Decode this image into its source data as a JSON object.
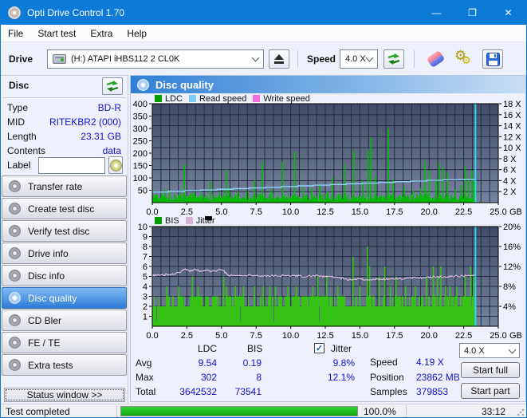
{
  "window": {
    "title": "Opti Drive Control 1.70",
    "controls": {
      "minimize": "—",
      "maximize": "❐",
      "close": "✕"
    }
  },
  "menubar": {
    "items": [
      "File",
      "Start test",
      "Extra",
      "Help"
    ]
  },
  "toolbar": {
    "drive_label": "Drive",
    "drive_value": "(H:)   ATAPI iHBS112   2 CL0K",
    "speed_label": "Speed",
    "speed_value": "4.0 X"
  },
  "sidebar": {
    "disc": {
      "header": "Disc",
      "fields": [
        {
          "label": "Type",
          "value": "BD-R"
        },
        {
          "label": "MID",
          "value": "RITEKBR2 (000)"
        },
        {
          "label": "Length",
          "value": "23.31 GB"
        },
        {
          "label": "Contents",
          "value": "data"
        }
      ],
      "label_field": {
        "label": "Label",
        "value": ""
      }
    },
    "nav_items": [
      {
        "label": "Transfer rate",
        "selected": false
      },
      {
        "label": "Create test disc",
        "selected": false
      },
      {
        "label": "Verify test disc",
        "selected": false
      },
      {
        "label": "Drive info",
        "selected": false
      },
      {
        "label": "Disc info",
        "selected": false
      },
      {
        "label": "Disc quality",
        "selected": true
      },
      {
        "label": "CD Bler",
        "selected": false
      },
      {
        "label": "FE / TE",
        "selected": false
      },
      {
        "label": "Extra tests",
        "selected": false
      }
    ],
    "status_window_button": "Status window >>"
  },
  "panel": {
    "title": "Disc quality"
  },
  "stats": {
    "col_ldc": "LDC",
    "col_bis": "BIS",
    "jitter_label": "Jitter",
    "jitter_checked": true,
    "check_glyph": "✓",
    "rows": [
      {
        "label": "Avg",
        "ldc": "9.54",
        "bis": "0.19",
        "jit": "9.8%"
      },
      {
        "label": "Max",
        "ldc": "302",
        "bis": "8",
        "jit": "12.1%"
      },
      {
        "label": "Total",
        "ldc": "3642532",
        "bis": "73541",
        "jit": ""
      }
    ],
    "speed_label": "Speed",
    "speed_value": "4.19 X",
    "position_label": "Position",
    "position_value": "23862 MB",
    "samples_label": "Samples",
    "samples_value": "379853",
    "speed_select": "4.0 X",
    "start_full": "Start full",
    "start_part": "Start part"
  },
  "statusbar": {
    "status": "Test completed",
    "progress_pct": 100,
    "progress_label": "100.0%",
    "time": "33:12"
  },
  "chart_data": [
    {
      "type": "bar",
      "legend": [
        {
          "label": "LDC",
          "color": "#00a000"
        },
        {
          "label": "Read speed",
          "color": "#7ecdf8"
        },
        {
          "label": "Write speed",
          "color": "#f56ee0"
        }
      ],
      "bar_color": "#00bb00",
      "read_line_color": "#8fd2f8",
      "end_line_color": "#2fd5f5",
      "x_axis": {
        "ticks": [
          "0.0",
          "2.5",
          "5.0",
          "7.5",
          "10.0",
          "12.5",
          "15.0",
          "17.5",
          "20.0",
          "22.5",
          "25.0"
        ],
        "unit": "GB",
        "max": 25,
        "data_end": 23.35,
        "divisions": 40
      },
      "left_axis": {
        "ticks": [
          "50",
          "100",
          "150",
          "200",
          "250",
          "300",
          "350",
          "400"
        ],
        "max": 400
      },
      "right_axis": {
        "ticks": [
          "2 X",
          "4 X",
          "6 X",
          "8 X",
          "10 X",
          "12 X",
          "14 X",
          "16 X",
          "18 X"
        ],
        "max": 18
      },
      "hgrid": "right",
      "ldc_baseline": {
        "min": 8,
        "max": 36
      },
      "ldc_spikes": [
        [
          0.35,
          30
        ],
        [
          0.95,
          55
        ],
        [
          1.25,
          45
        ],
        [
          1.6,
          34
        ],
        [
          2.3,
          155
        ],
        [
          3.0,
          42
        ],
        [
          3.6,
          34
        ],
        [
          4.2,
          88
        ],
        [
          4.85,
          40
        ],
        [
          5.35,
          135
        ],
        [
          5.55,
          60
        ],
        [
          6.2,
          46
        ],
        [
          6.8,
          38
        ],
        [
          7.4,
          90
        ],
        [
          7.95,
          165
        ],
        [
          8.6,
          55
        ],
        [
          9.4,
          165
        ],
        [
          10.3,
          207
        ],
        [
          10.9,
          65
        ],
        [
          11.5,
          60
        ],
        [
          12.1,
          70
        ],
        [
          12.65,
          46
        ],
        [
          13.0,
          100
        ],
        [
          13.9,
          158
        ],
        [
          14.55,
          210
        ],
        [
          15.2,
          88
        ],
        [
          15.6,
          215
        ],
        [
          15.8,
          265
        ],
        [
          16.1,
          110
        ],
        [
          17.05,
          300
        ],
        [
          17.4,
          92
        ],
        [
          18.2,
          65
        ],
        [
          18.85,
          50
        ],
        [
          19.4,
          60
        ],
        [
          19.7,
          170
        ],
        [
          20.0,
          130
        ],
        [
          20.5,
          95
        ],
        [
          20.7,
          160
        ],
        [
          21.0,
          140
        ],
        [
          21.3,
          120
        ],
        [
          21.9,
          55
        ],
        [
          22.3,
          70
        ],
        [
          22.6,
          145
        ],
        [
          22.85,
          100
        ],
        [
          23.1,
          130
        ],
        [
          23.25,
          90
        ]
      ],
      "read_speed_steps": [
        [
          0,
          1.93
        ],
        [
          1.17,
          2.05
        ],
        [
          2.34,
          2.18
        ],
        [
          3.5,
          2.3
        ],
        [
          4.67,
          2.43
        ],
        [
          5.84,
          2.55
        ],
        [
          7.0,
          2.68
        ],
        [
          8.17,
          2.8
        ],
        [
          9.34,
          2.93
        ],
        [
          10.5,
          3.05
        ],
        [
          11.67,
          3.18
        ],
        [
          12.84,
          3.3
        ],
        [
          14.0,
          3.43
        ],
        [
          15.17,
          3.55
        ],
        [
          16.34,
          3.68
        ],
        [
          17.5,
          3.8
        ],
        [
          18.67,
          3.93
        ],
        [
          19.84,
          4.05
        ],
        [
          21.0,
          4.14
        ],
        [
          22.17,
          4.22
        ],
        [
          23.35,
          4.28
        ]
      ]
    },
    {
      "type": "bar",
      "legend": [
        {
          "label": "BIS",
          "color": "#00a000"
        },
        {
          "label": "Jitter",
          "color": "#d8b0d8"
        }
      ],
      "bar_color": "#35c214",
      "jitter_line_color": "#ecccea",
      "end_line_color": "#2fd5f5",
      "x_axis": {
        "ticks": [
          "0.0",
          "2.5",
          "5.0",
          "7.5",
          "10.0",
          "12.5",
          "15.0",
          "17.5",
          "20.0",
          "22.5",
          "25.0"
        ],
        "unit": "GB",
        "max": 25,
        "data_end": 23.35,
        "divisions": 40
      },
      "left_axis": {
        "ticks": [
          "1",
          "2",
          "3",
          "4",
          "5",
          "6",
          "7",
          "8",
          "9",
          "10"
        ],
        "max": 10
      },
      "right_axis": {
        "ticks": [
          "4%",
          "8%",
          "12%",
          "16%",
          "20%"
        ],
        "max": 20
      },
      "hgrid": "left",
      "base_level": 2,
      "bar3_density": 0.5,
      "bis_spikes": [
        [
          1.05,
          4
        ],
        [
          1.9,
          4
        ],
        [
          2.9,
          5
        ],
        [
          3.3,
          4
        ],
        [
          5.15,
          5
        ],
        [
          5.35,
          4
        ],
        [
          6.0,
          4
        ],
        [
          6.6,
          4
        ],
        [
          7.4,
          4
        ],
        [
          8.0,
          4
        ],
        [
          8.5,
          4
        ],
        [
          8.9,
          4
        ],
        [
          9.8,
          4
        ],
        [
          10.4,
          4
        ],
        [
          11.6,
          4
        ],
        [
          11.95,
          5
        ],
        [
          12.6,
          5
        ],
        [
          13.4,
          4
        ],
        [
          14.5,
          7
        ],
        [
          15.0,
          4
        ],
        [
          15.55,
          8
        ],
        [
          15.7,
          6
        ],
        [
          16.4,
          5
        ],
        [
          16.8,
          6
        ],
        [
          17.2,
          4
        ],
        [
          17.6,
          5
        ],
        [
          18.3,
          4
        ],
        [
          19.0,
          4
        ],
        [
          19.8,
          5
        ],
        [
          20.3,
          6
        ],
        [
          20.6,
          5
        ],
        [
          20.85,
          6
        ],
        [
          21.2,
          4
        ],
        [
          21.5,
          4
        ],
        [
          22.0,
          4
        ],
        [
          22.6,
          5
        ],
        [
          23.0,
          6
        ],
        [
          23.2,
          5
        ]
      ],
      "jitter_pct": [
        [
          0,
          10.1
        ],
        [
          0.4,
          10.35
        ],
        [
          0.8,
          10.2
        ],
        [
          1.2,
          10.5
        ],
        [
          1.6,
          10.4
        ],
        [
          2.0,
          10.9
        ],
        [
          2.4,
          11.5
        ],
        [
          2.7,
          11.1
        ],
        [
          3.1,
          11.4
        ],
        [
          3.5,
          11.0
        ],
        [
          3.9,
          11.3
        ],
        [
          4.3,
          11.0
        ],
        [
          4.7,
          11.2
        ],
        [
          5.1,
          11.4
        ],
        [
          5.4,
          10.3
        ],
        [
          6.0,
          10.1
        ],
        [
          7.0,
          10.2
        ],
        [
          8.0,
          10.1
        ],
        [
          9.0,
          10.15
        ],
        [
          10.0,
          10.1
        ],
        [
          11.0,
          10.05
        ],
        [
          12.0,
          10.1
        ],
        [
          13.0,
          9.9
        ],
        [
          13.6,
          9.7
        ],
        [
          14.2,
          9.3
        ],
        [
          14.8,
          9.5
        ],
        [
          15.4,
          9.35
        ],
        [
          16.0,
          9.45
        ],
        [
          16.6,
          9.4
        ],
        [
          17.2,
          9.5
        ],
        [
          18.0,
          9.55
        ],
        [
          19.0,
          9.7
        ],
        [
          20.0,
          9.8
        ],
        [
          20.8,
          9.9
        ],
        [
          21.6,
          10.0
        ],
        [
          22.4,
          10.1
        ],
        [
          23.0,
          10.2
        ],
        [
          23.35,
          10.35
        ]
      ]
    }
  ]
}
